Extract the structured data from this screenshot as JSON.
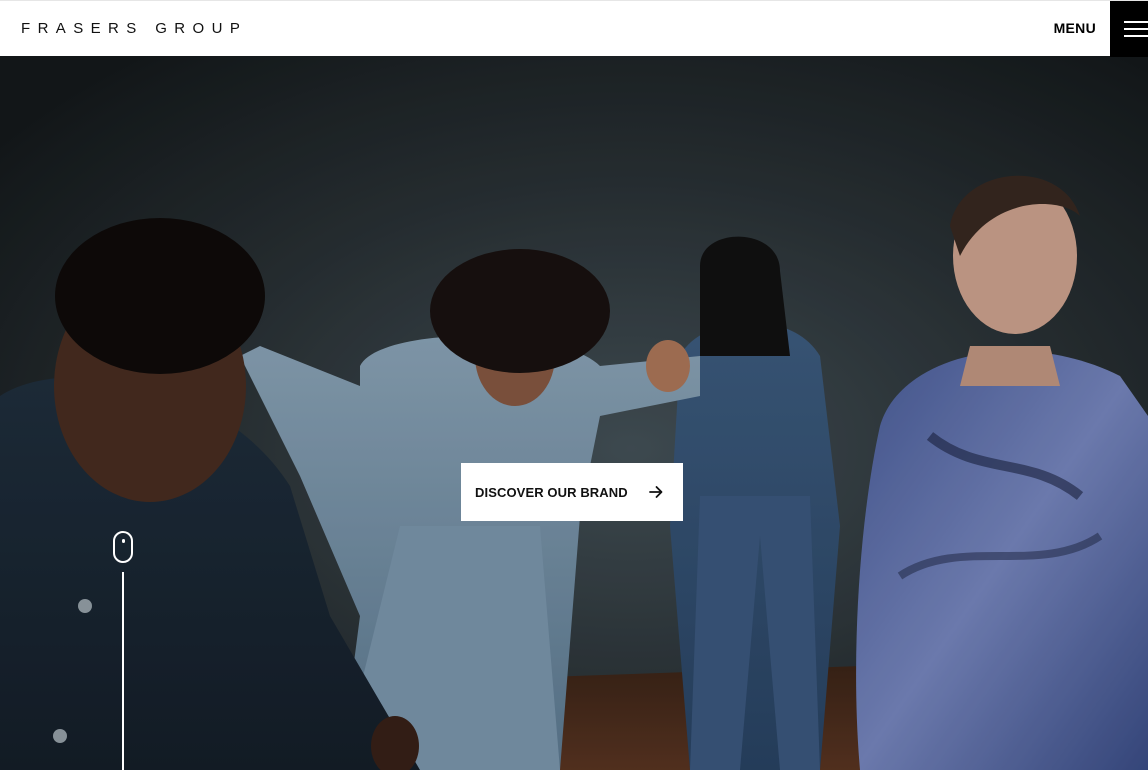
{
  "header": {
    "logo_text": "FRASERS GROUP",
    "menu_label": "MENU",
    "menu_icon": "hamburger-icon"
  },
  "hero": {
    "image_description_icon": "hero-photo",
    "cta_label": "DISCOVER OUR BRAND",
    "cta_icon": "arrow-right-icon",
    "scroll_icon": "mouse-scroll-icon"
  },
  "colors": {
    "header_bg": "#ffffff",
    "menu_button_bg": "#000000",
    "hero_bg": "#1c2124",
    "cta_bg": "#ffffff",
    "text_dark": "#111111"
  }
}
